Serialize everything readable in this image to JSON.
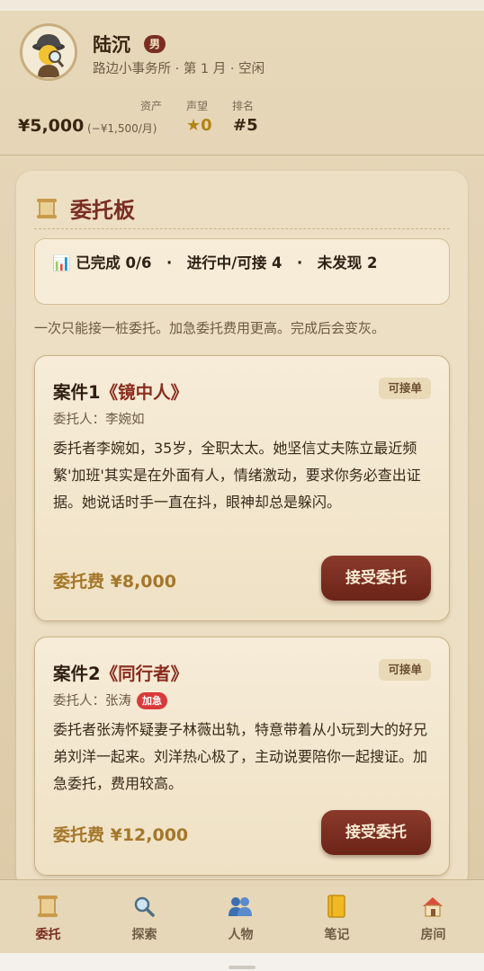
{
  "profile": {
    "name": "陆沉",
    "gender": "男",
    "subline": "路边小事务所 · 第 1 月 · 空闲",
    "labels": {
      "assets": "资产",
      "reputation": "声望",
      "rank": "排名"
    },
    "money": "¥5,000",
    "money_sub": "(−¥1,500/月)",
    "reputation": "★0",
    "rank": "#5"
  },
  "board": {
    "title": "委托板",
    "summary": "📊 已完成 0/6　·　进行中/可接 4　·　未发现 2",
    "hint": "一次只能接一桩委托。加急委托费用更高。完成后会变灰。"
  },
  "cases": [
    {
      "title_prefix": "案件1",
      "title_name": "《镜中人》",
      "tag": "可接单",
      "client": "委托人：李婉如",
      "urgent": "",
      "description": "委托者李婉如，35岁，全职太太。她坚信丈夫陈立最近频繁'加班'其实是在外面有人，情绪激动，要求你务必查出证据。她说话时手一直在抖，眼神却总是躲闪。",
      "fee": "委托费 ¥8,000",
      "button": "接受委托"
    },
    {
      "title_prefix": "案件2",
      "title_name": "《同行者》",
      "tag": "可接单",
      "client": "委托人：张涛",
      "urgent": "加急",
      "description": "委托者张涛怀疑妻子林薇出轨，特意带着从小玩到大的好兄弟刘洋一起来。刘洋热心极了，主动说要陪你一起搜证。加急委托，费用较高。",
      "fee": "委托费 ¥12,000",
      "button": "接受委托"
    }
  ],
  "nav": [
    {
      "label": "委托",
      "icon": "scroll-icon",
      "active": true
    },
    {
      "label": "探索",
      "icon": "magnifier-icon",
      "active": false
    },
    {
      "label": "人物",
      "icon": "people-icon",
      "active": false
    },
    {
      "label": "笔记",
      "icon": "notebook-icon",
      "active": false
    },
    {
      "label": "房间",
      "icon": "house-icon",
      "active": false
    }
  ],
  "colors": {
    "accent": "#7a2e22",
    "fee": "#a4772a",
    "urgent": "#d93a3a",
    "background": "#e7d8ba"
  }
}
